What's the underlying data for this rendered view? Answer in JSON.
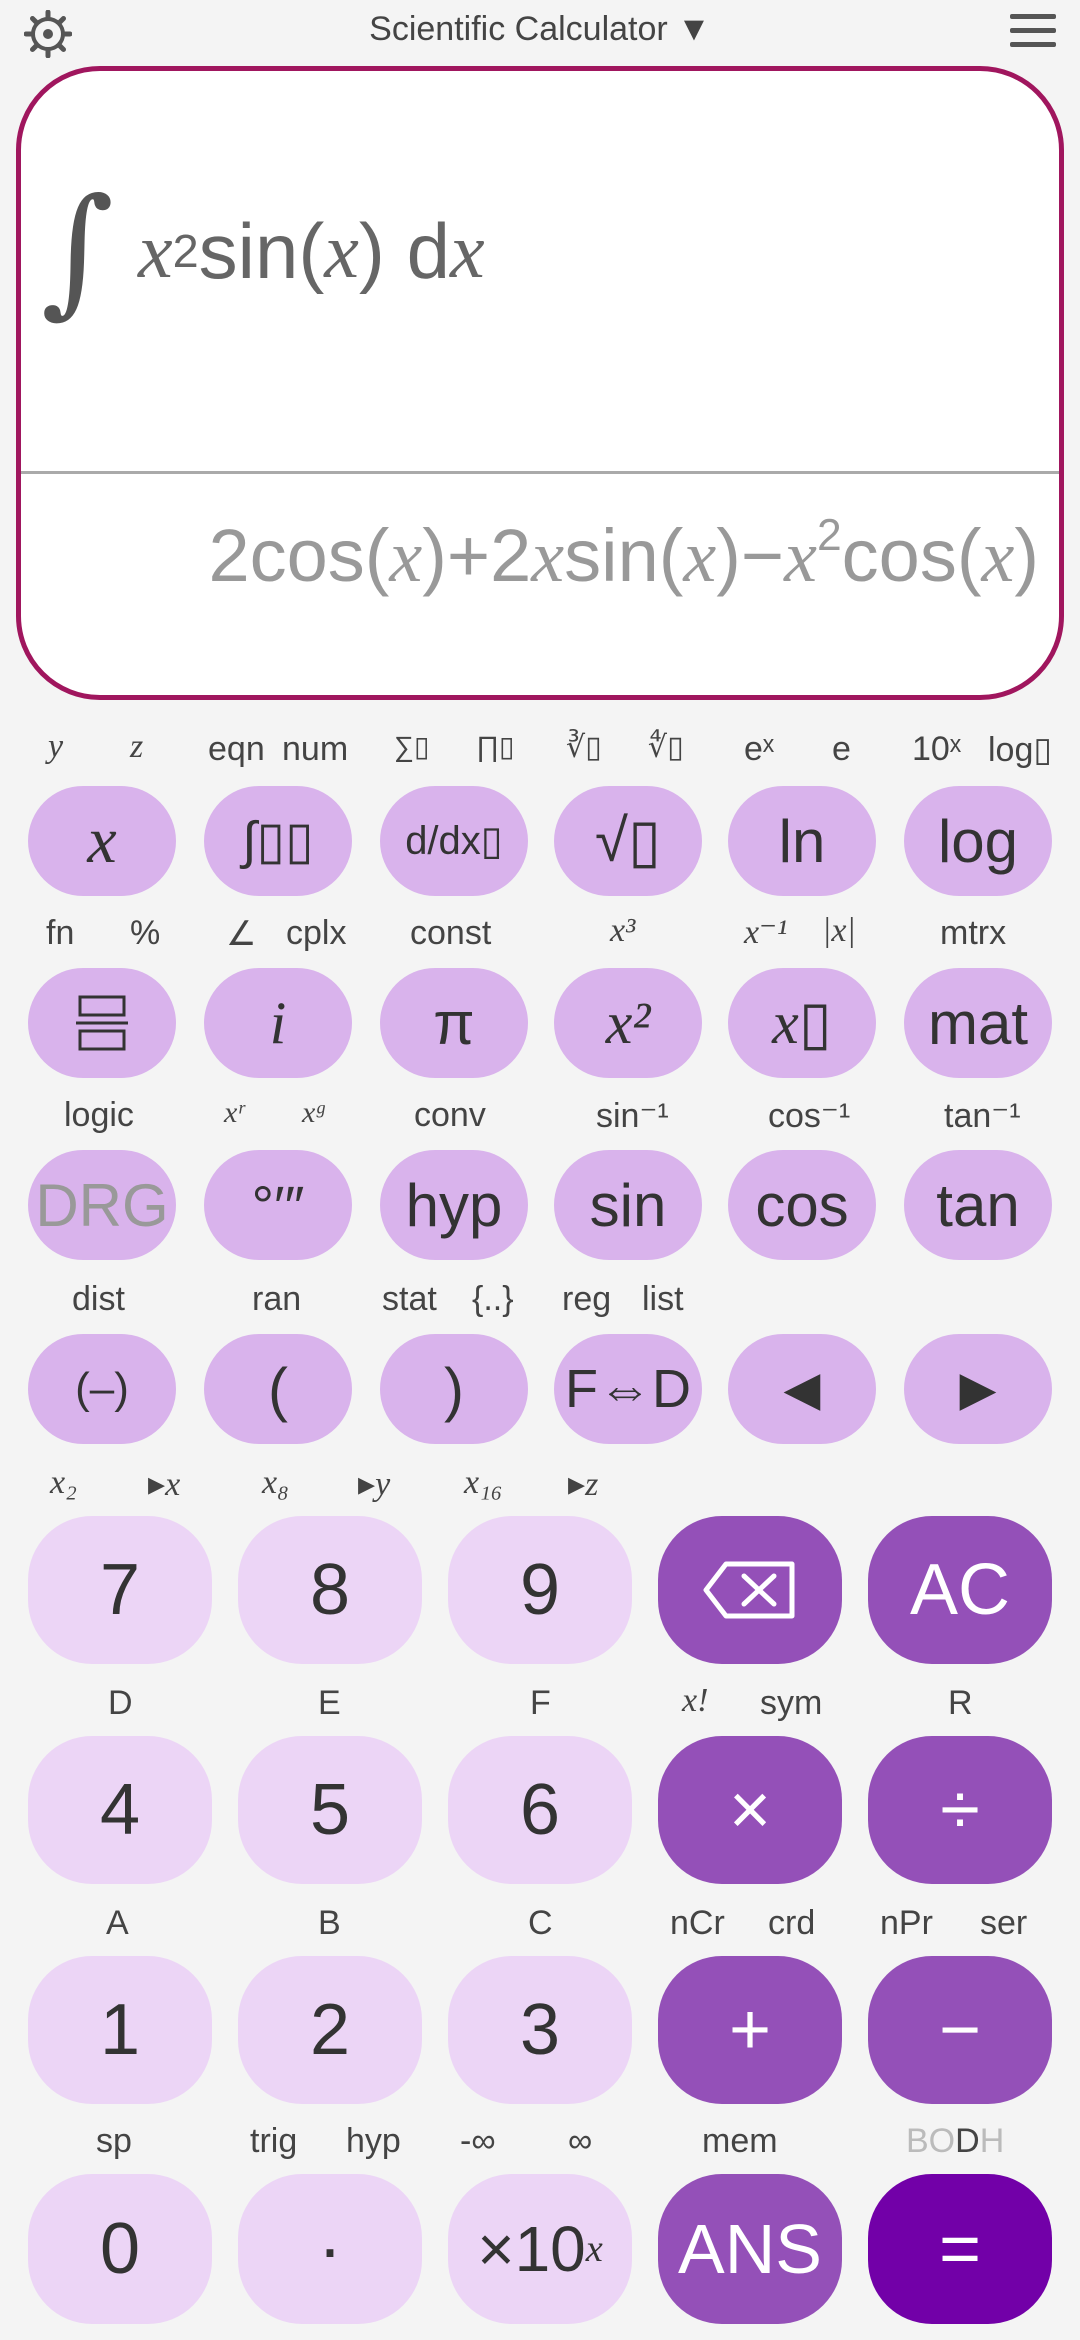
{
  "app": {
    "title": "Scientific Calculator ▼"
  },
  "icons": {
    "settings": "gear-icon",
    "menu": "hamburger-icon",
    "backspace": "backspace-icon"
  },
  "display": {
    "expression_parts": [
      "x",
      "2",
      "sin(",
      "x",
      ") d",
      "x"
    ],
    "result_parts": [
      "2cos(",
      "x",
      ")+2",
      "x",
      "sin(",
      "x",
      ")−",
      "x",
      "2",
      "cos(",
      "x",
      ")"
    ]
  },
  "colors": {
    "display_border": "#a0165e",
    "fn_key": "#d9b3ec",
    "num_key": "#ecd5f6",
    "op_key": "#9450b8",
    "equals_key": "#7200a8"
  },
  "rows": {
    "r1_labels": [
      "y",
      "z",
      "eqn",
      "num",
      "∑▯",
      "∏▯",
      "∛▯",
      "∜▯",
      "eˣ",
      "e",
      "10ˣ",
      "log▯"
    ],
    "r1_keys": [
      "x",
      "∫▯▯",
      "d/dx▯",
      "√▯",
      "ln",
      "log"
    ],
    "r2_labels": [
      "fn",
      "%",
      "∠",
      "cplx",
      "const",
      "x³",
      "x⁻¹",
      "|x|",
      "mtrx"
    ],
    "r2_keys": [
      "frac",
      "i",
      "π",
      "x²",
      "x▯",
      "mat"
    ],
    "r3_labels": [
      "logic",
      "xʳ",
      "xᵍ",
      "conv",
      "sin⁻¹",
      "cos⁻¹",
      "tan⁻¹"
    ],
    "r3_keys": [
      "DRG",
      "°′″",
      "hyp",
      "sin",
      "cos",
      "tan"
    ],
    "r4_labels": [
      "dist",
      "ran",
      "stat",
      "{..}",
      "reg",
      "list"
    ],
    "r4_keys": [
      "(–)",
      "(",
      ")",
      "F⇔D",
      "◀",
      "▶"
    ],
    "r5_labels": [
      "x₂",
      "▸x",
      "x₈",
      "▸y",
      "x₁₆",
      "▸z"
    ],
    "r5_keys": [
      "7",
      "8",
      "9",
      "⌫",
      "AC"
    ],
    "r6_labels": [
      "D",
      "E",
      "F",
      "x!",
      "sym",
      "R"
    ],
    "r6_keys": [
      "4",
      "5",
      "6",
      "×",
      "÷"
    ],
    "r7_labels": [
      "A",
      "B",
      "C",
      "nCr",
      "crd",
      "nPr",
      "ser"
    ],
    "r7_keys": [
      "1",
      "2",
      "3",
      "+",
      "−"
    ],
    "r8_labels": [
      "sp",
      "trig",
      "hyp",
      "-∞",
      "∞",
      "mem",
      "BO",
      "D",
      "H"
    ],
    "r8_keys": [
      "0",
      "·",
      "×10",
      "x",
      "ANS",
      "="
    ]
  }
}
